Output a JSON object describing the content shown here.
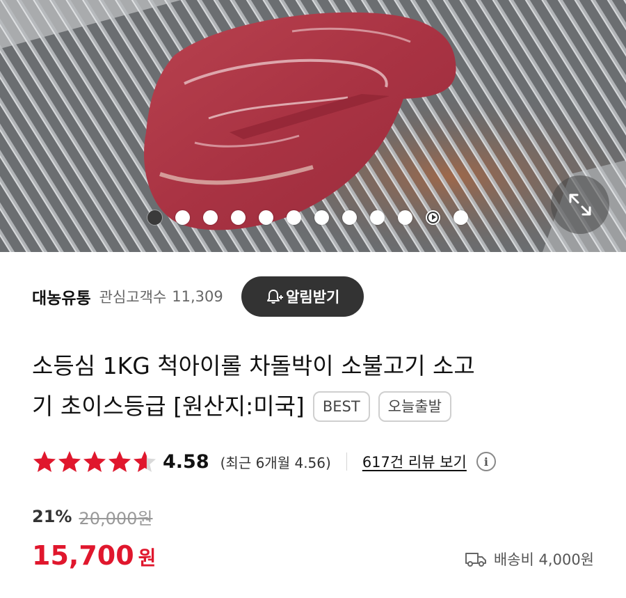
{
  "hero": {
    "image_alt": "steak-on-grill-photo",
    "slide_count": 12,
    "active_slide": 1,
    "video_slide": 11,
    "expand_icon": "expand-icon"
  },
  "seller": {
    "name": "대농유통",
    "fans_label": "관심고객수",
    "fans_count": "11,309",
    "alarm_label": "알림받기",
    "alarm_icon": "bell-plus-icon"
  },
  "product": {
    "title_line1": "소등심 1KG 척아이롤 차돌박이 소불고기 소고",
    "title_line2": "기 초이스등급 [원산지:미국]",
    "badges": [
      "BEST",
      "오늘출발"
    ]
  },
  "rating": {
    "value": "4.58",
    "stars_filled": 4.58,
    "recent": "(최근 6개월 4.56)",
    "review_link": "617건 리뷰 보기",
    "info_icon": "info-icon",
    "star_color": "#e0172d"
  },
  "price": {
    "discount_rate": "21%",
    "original": "20,000원",
    "final": "15,700",
    "unit": "원",
    "accent_color": "#e0172d"
  },
  "shipping": {
    "icon": "truck-icon",
    "label": "배송비 4,000원"
  }
}
